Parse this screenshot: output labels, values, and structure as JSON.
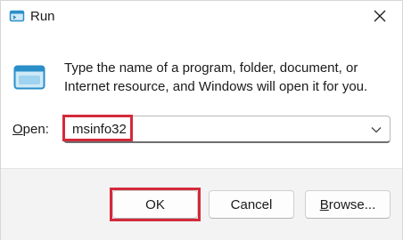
{
  "window": {
    "title": "Run",
    "close_glyph": "✕",
    "title_icon": "run-app-icon"
  },
  "body": {
    "app_icon": "run-app-icon",
    "description": "Type the name of a program, folder, document, or Internet resource, and Windows will open it for you."
  },
  "open": {
    "label_accel": "O",
    "label_rest": "pen:",
    "value": "msinfo32",
    "dropdown_icon": "chevron-down-icon"
  },
  "buttons": {
    "ok_label": "OK",
    "cancel_label": "Cancel",
    "browse_accel": "B",
    "browse_rest": "rowse..."
  },
  "colors": {
    "highlight": "#d32a3a",
    "accent": "#2a8fc9"
  }
}
